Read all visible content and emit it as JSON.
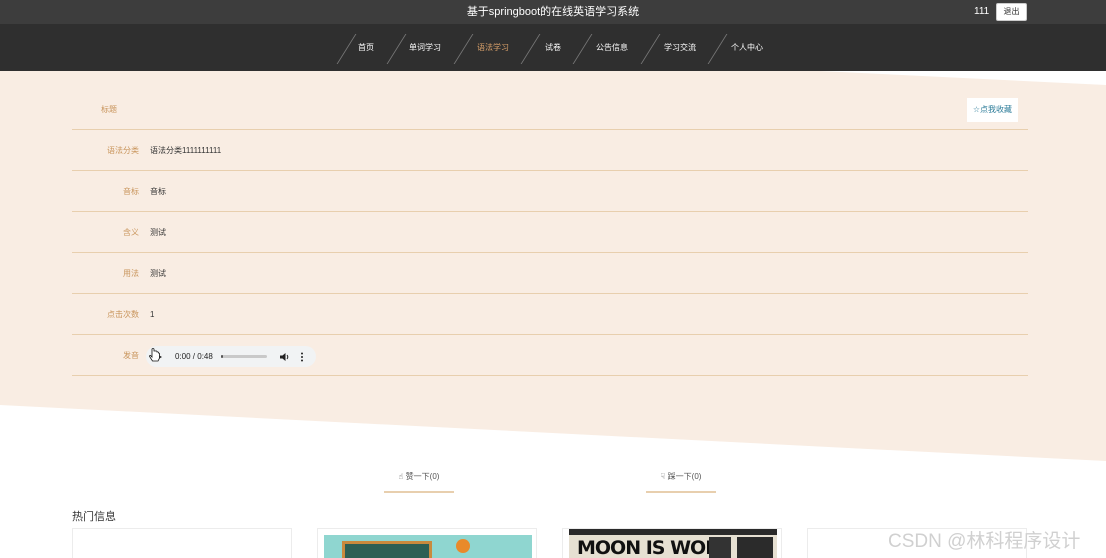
{
  "header": {
    "site_title": "基于springboot的在线英语学习系统",
    "user_name": "111",
    "logout_label": "退出"
  },
  "nav": {
    "items": [
      "首页",
      "单词学习",
      "语法学习",
      "试卷",
      "公告信息",
      "学习交流",
      "个人中心"
    ],
    "active_index": 2
  },
  "detail": {
    "title_label": "标题",
    "favorite_label": "☆点我收藏",
    "rows": [
      {
        "label": "语法分类",
        "value": "语法分类1111111111"
      },
      {
        "label": "音标",
        "value": "音标"
      },
      {
        "label": "含义",
        "value": "测试"
      },
      {
        "label": "用法",
        "value": "测试"
      },
      {
        "label": "点击次数",
        "value": "1"
      },
      {
        "label": "发音",
        "value": ""
      }
    ]
  },
  "audio": {
    "time": "0:00 / 0:48",
    "progress": 0.05
  },
  "votes": {
    "up_label": "赞一下(0)",
    "down_label": "踩一下(0)"
  },
  "hot": {
    "title": "热门信息",
    "card_headline": "MOON IS WON"
  },
  "watermark": "CSDN @林科程序设计",
  "colors": {
    "topbar": "#3d3d3d",
    "navbar": "#2f2f2f",
    "accent": "#d9a06a",
    "band": "#f9ede3",
    "label": "#c9955c"
  }
}
